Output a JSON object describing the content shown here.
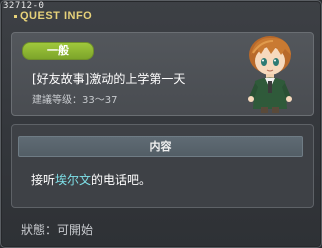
{
  "quest_id": "32712-0",
  "window_title": "QUEST INFO",
  "category_badge": "一般",
  "quest_name": "[好友故事]激动的上学第一天",
  "level_recommendation": "建議等级：33～37",
  "content_header": "内容",
  "content": {
    "before": "接听",
    "highlight": "埃尔文",
    "after": "的电话吧。"
  },
  "status": "狀態：可開始",
  "colors": {
    "title_yellow": "#e7d27a",
    "badge_green": "#8db532",
    "highlight_cyan": "#7ee0e8"
  },
  "icons": [
    "npc-portrait"
  ]
}
